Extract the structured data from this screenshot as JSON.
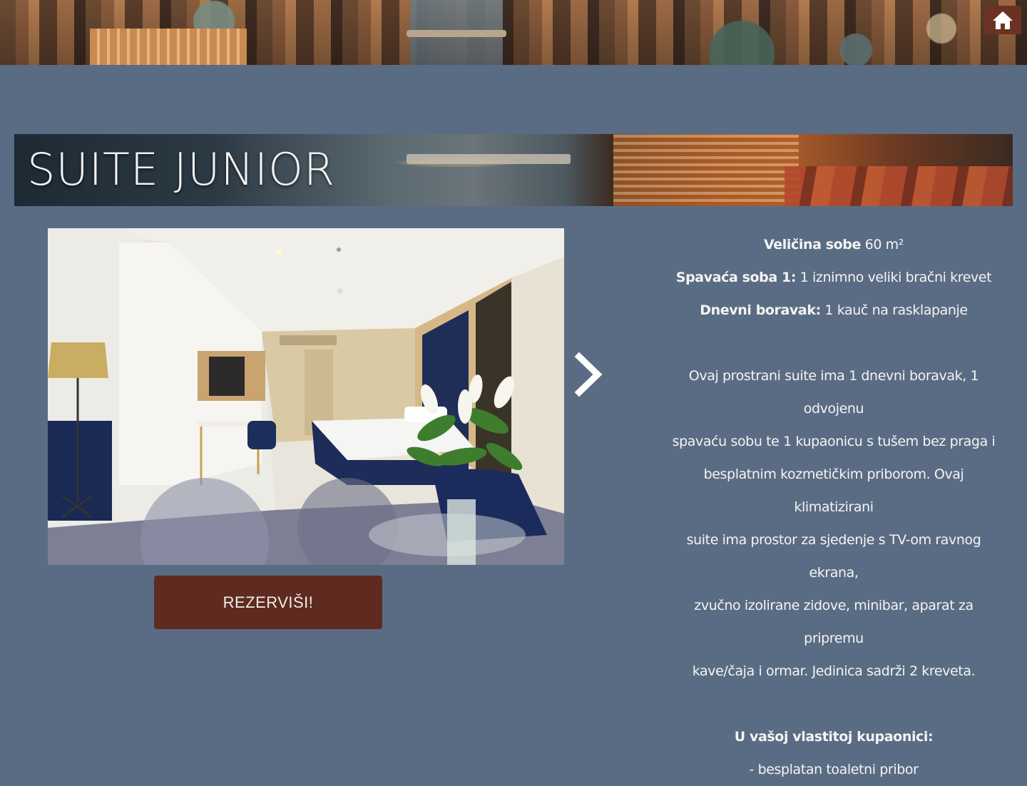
{
  "header": {
    "home_icon": "home-icon"
  },
  "room": {
    "title": "SUITE JUNIOR",
    "reserve_label": "REZERVIŠI!",
    "next_icon": "chevron-right-icon",
    "details": [
      {
        "label": "Veličina sobe",
        "value": "60 m²"
      },
      {
        "label": "Spavaća soba 1:",
        "value": "1 iznimno veliki bračni krevet"
      },
      {
        "label": "Dnevni boravak:",
        "value": "1 kauč na rasklapanje"
      }
    ],
    "description_lines": [
      "Ovaj prostrani suite ima 1 dnevni boravak, 1 odvojenu",
      "spavaću sobu te 1 kupaonicu s tušem bez praga i",
      "besplatnim kozmetičkim priborom. Ovaj klimatizirani",
      "suite ima prostor za sjedenje s TV-om ravnog ekrana,",
      "zvučno izolirane zidove, minibar, aparat za pripremu",
      "kave/čaja i ormar. Jedinica sadrži 2 kreveta."
    ],
    "bathroom_heading": "U vašoj vlastitoj kupaonici:",
    "bathroom_items": [
      "- besplatan toaletni pribor"
    ]
  },
  "colors": {
    "page_bg": "#5a6c83",
    "button_bg": "#5f2b20",
    "home_bg": "#6b3223",
    "text": "#f4f4f4"
  }
}
